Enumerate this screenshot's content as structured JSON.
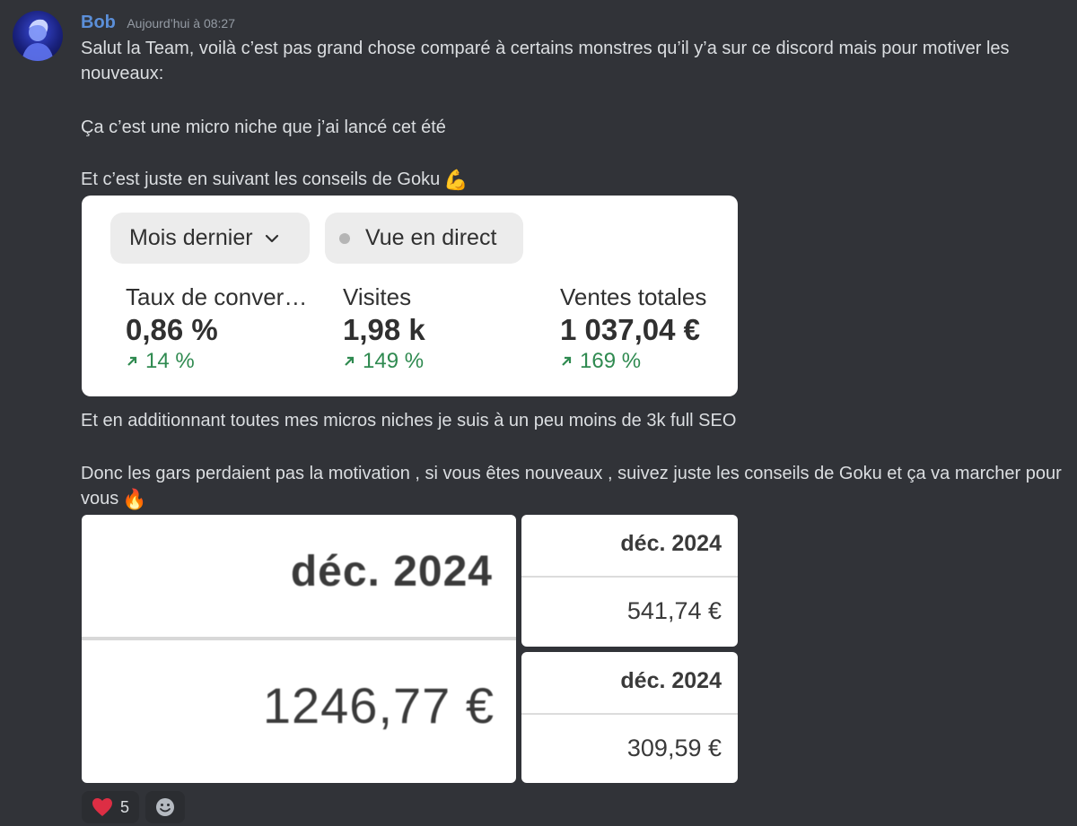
{
  "message": {
    "author": "Bob",
    "timestamp": "Aujourd’hui à 08:27",
    "lines": {
      "intro": "Salut la Team, voilà c’est pas grand chose comparé à certains monstres qu’il y’a sur ce discord mais pour motiver les nouveaux:",
      "niche": "Ça c’est une micro niche que j’ai lancé cet été",
      "goku": "Et c’est juste en suivant les conseils de Goku",
      "total": "Et en additionnant toutes mes micros niches je suis à un peu moins de 3k full SEO",
      "closing": "Donc les gars perdaient pas la motivation , si vous êtes nouveaux , suivez juste les conseils de Goku et ça va marcher pour vous"
    },
    "emojis": {
      "flex": "💪",
      "fire": "🔥"
    }
  },
  "analytics_card": {
    "period_selector": "Mois dernier",
    "live_button": "Vue en direct",
    "metrics": [
      {
        "label": "Taux de conver…",
        "value": "0,86 %",
        "change": "14 %"
      },
      {
        "label": "Visites",
        "value": "1,98 k",
        "change": "149 %"
      },
      {
        "label": "Ventes totales",
        "value": "1 037,04 €",
        "change": "169 %"
      }
    ],
    "change_color": "#2f8a50"
  },
  "attachments": [
    {
      "date": "déc. 2024",
      "amount": "1246,77 €"
    },
    {
      "date": "déc. 2024",
      "amount": "541,74 €"
    },
    {
      "date": "déc. 2024",
      "amount": "309,59 €"
    }
  ],
  "reactions": [
    {
      "emoji": "heart",
      "count": "5"
    }
  ],
  "colors": {
    "background": "#313338",
    "username": "#5b8fd9",
    "text": "#dbdee1",
    "timestamp": "#949ba4"
  }
}
